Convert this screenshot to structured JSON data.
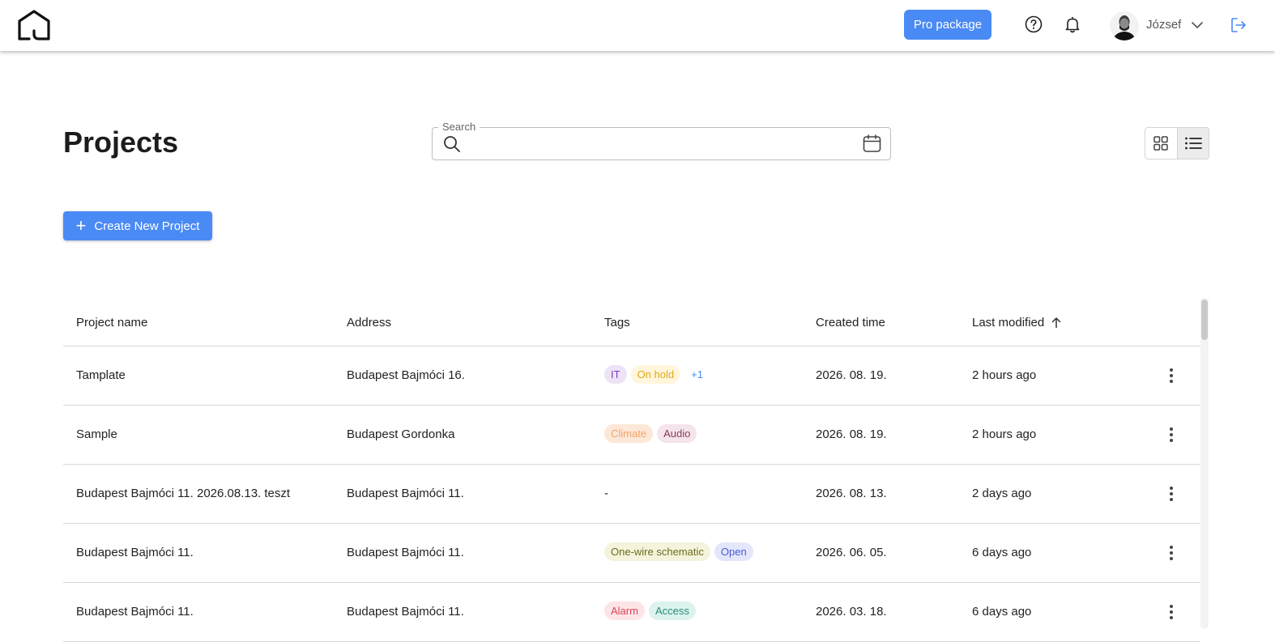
{
  "header": {
    "pro_label": "Pro package",
    "user_name": "József"
  },
  "page": {
    "title": "Projects",
    "search_label": "Search",
    "search_value": "",
    "create_label": "Create New Project"
  },
  "table": {
    "columns": {
      "name": "Project name",
      "address": "Address",
      "tags": "Tags",
      "created": "Created time",
      "modified": "Last modified"
    },
    "rows": [
      {
        "name": "Tamplate",
        "address": "Budapest Bajmóci 16.",
        "tags": [
          {
            "label": "IT",
            "bg": "#ede3f7",
            "fg": "#7a3fb5"
          },
          {
            "label": "On hold",
            "bg": "#fff6dc",
            "fg": "#e0a91a"
          }
        ],
        "more": "+1",
        "created": "2026. 08. 19.",
        "modified": "2 hours ago"
      },
      {
        "name": "Sample",
        "address": "Budapest Gordonka",
        "tags": [
          {
            "label": "Climate",
            "bg": "#fde8d8",
            "fg": "#f0a36a"
          },
          {
            "label": "Audio",
            "bg": "#f4e4ec",
            "fg": "#8c3a5e"
          }
        ],
        "more": "",
        "created": "2026. 08. 19.",
        "modified": "2 hours ago"
      },
      {
        "name": "Budapest Bajmóci 11. 2026.08.13. teszt",
        "address": "Budapest Bajmóci 11.",
        "tags": [],
        "no_tags": "-",
        "more": "",
        "created": "2026. 08. 13.",
        "modified": "2 days ago"
      },
      {
        "name": "Budapest Bajmóci 11.",
        "address": "Budapest Bajmóci 11.",
        "tags": [
          {
            "label": "One-wire schematic",
            "bg": "#f4f4dc",
            "fg": "#6c6c1e"
          },
          {
            "label": "Open",
            "bg": "#e4e7fb",
            "fg": "#4a5bd6"
          }
        ],
        "more": "",
        "created": "2026. 06. 05.",
        "modified": "6 days ago"
      },
      {
        "name": "Budapest Bajmóci 11.",
        "address": "Budapest Bajmóci 11.",
        "tags": [
          {
            "label": "Alarm",
            "bg": "#fde4e6",
            "fg": "#d8455a"
          },
          {
            "label": "Access",
            "bg": "#dcf3ee",
            "fg": "#2a8c74"
          }
        ],
        "more": "",
        "created": "2026. 03. 18.",
        "modified": "6 days ago"
      }
    ]
  },
  "icons": {
    "logo": "house-logo-icon",
    "help": "help-circle-icon",
    "bell": "bell-icon",
    "chevron": "chevron-down-icon",
    "logout": "logout-icon",
    "search": "search-icon",
    "calendar": "calendar-icon",
    "grid": "grid-view-icon",
    "list": "list-view-icon",
    "sort": "sort-arrow-up-icon",
    "kebab": "kebab-menu-icon"
  },
  "colors": {
    "accent": "#4a8af4"
  }
}
